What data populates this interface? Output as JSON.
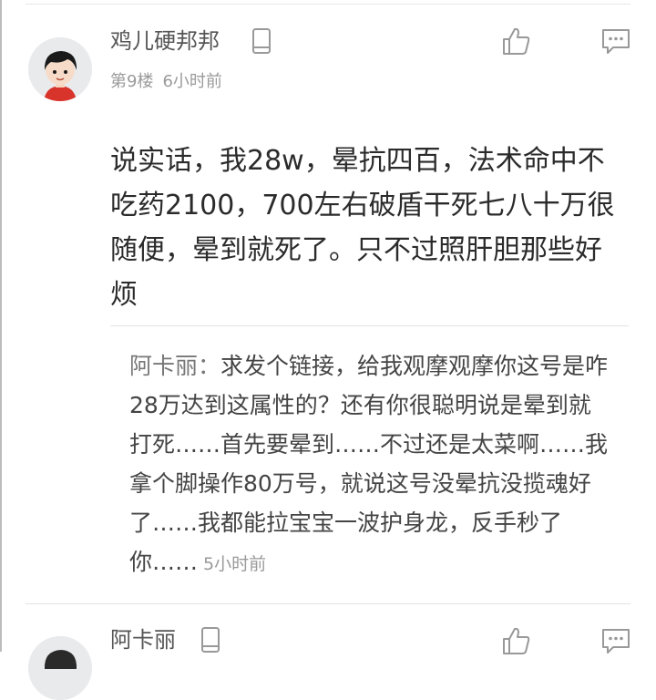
{
  "comment": {
    "username": "鸡儿硬邦邦",
    "floor": "第9楼",
    "time": "6小时前",
    "text": "说实话，我28w，晕抗四百，法术命中不吃药2100，700左右破盾干死七八十万很随便，晕到就死了。只不过照肝胆那些好烦"
  },
  "reply": {
    "author": "阿卡丽：",
    "text": "求发个链接，给我观摩观摩你这号是咋28万达到这属性的？还有你很聪明说是晕到就打死……首先要晕到……不过还是太菜啊……我拿个脚操作80万号，就说这号没晕抗没揽魂好了……我都能拉宝宝一波护身龙，反手秒了你……",
    "time": "5小时前"
  },
  "next_comment": {
    "username": "阿卡丽"
  },
  "icons": {
    "device": "phone-icon",
    "like": "thumbs-up-icon",
    "reply": "comment-bubble-icon"
  },
  "colors": {
    "text_primary": "#2b2b2b",
    "text_secondary": "#9a9a9a",
    "divider": "#e3e3e3",
    "icon": "#999999"
  }
}
